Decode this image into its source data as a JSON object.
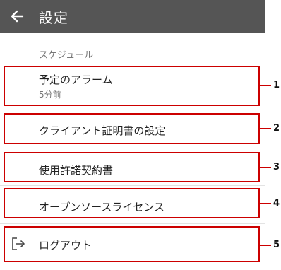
{
  "header": {
    "title": "設定",
    "back_icon": "arrow-left-icon",
    "background": "#555555"
  },
  "section": {
    "label": "スケジュール"
  },
  "items": [
    {
      "label": "予定のアラーム",
      "value": "5分前"
    },
    {
      "label": "クライアント証明書の設定"
    },
    {
      "label": "使用許諾契約書"
    },
    {
      "label": "オープンソースライセンス"
    },
    {
      "label": "ログアウト",
      "icon": "logout-icon"
    }
  ],
  "callouts": [
    "1",
    "2",
    "3",
    "4",
    "5"
  ],
  "colors": {
    "callout": "#cc0000",
    "divider": "#e3e3e3"
  }
}
